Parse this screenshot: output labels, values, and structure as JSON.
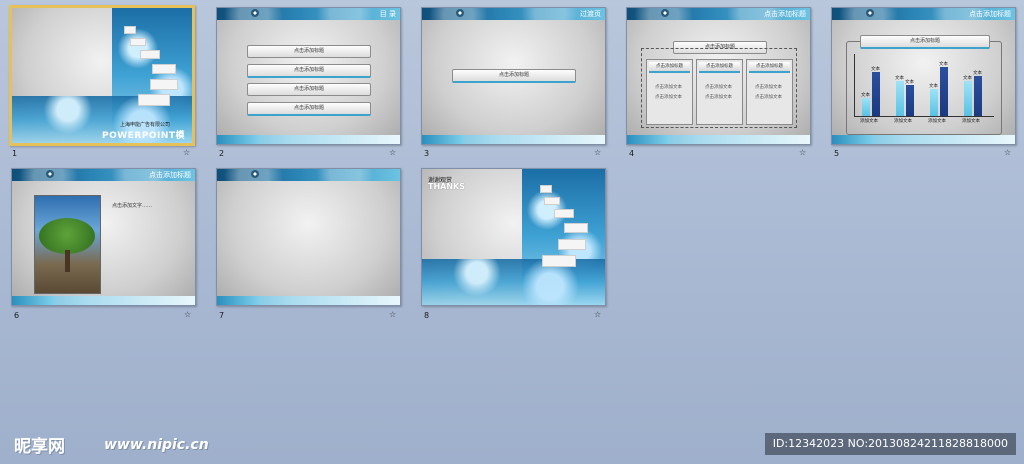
{
  "slides": [
    {
      "number": "1",
      "subtitle": "上海申能广告有限公司",
      "title": "POWERPOINT模板"
    },
    {
      "number": "2",
      "header": "目 录",
      "items": [
        "点击添加标题",
        "点击添加标题",
        "点击添加标题",
        "点击添加标题"
      ]
    },
    {
      "number": "3",
      "header": "过渡页",
      "button": "点击添加标题"
    },
    {
      "number": "4",
      "header": "点击添加标题",
      "top": "点击添加标题",
      "panels": [
        {
          "head": "点击添加标题",
          "lines": [
            "点击添加文本",
            "点击添加文本"
          ]
        },
        {
          "head": "点击添加标题",
          "lines": [
            "点击添加文本",
            "点击添加文本"
          ]
        },
        {
          "head": "点击添加标题",
          "lines": [
            "点击添加文本",
            "点击添加文本"
          ]
        }
      ]
    },
    {
      "number": "5",
      "header": "点击添加标题",
      "chart_title": "点击添加标题"
    },
    {
      "number": "6",
      "header": "点击添加标题",
      "text": "点击添加文字……"
    },
    {
      "number": "7"
    },
    {
      "number": "8",
      "line1": "谢谢观赏",
      "line2": "THANKS"
    }
  ],
  "star_icon": "☆",
  "chart_data": {
    "type": "bar",
    "title": "点击添加标题",
    "categories": [
      "添加文本",
      "添加文本",
      "添加文本",
      "添加文本"
    ],
    "series": [
      {
        "values": [
          2,
          4,
          3,
          4
        ]
      },
      {
        "values": [
          5,
          3.5,
          5.5,
          4.5
        ]
      }
    ],
    "data_label": "文本",
    "ylim": [
      0,
      7
    ]
  },
  "watermark": {
    "logo": "昵享网",
    "url": "www.nipic.cn"
  },
  "image_id": "ID:12342023 NO:20130824211828818000"
}
